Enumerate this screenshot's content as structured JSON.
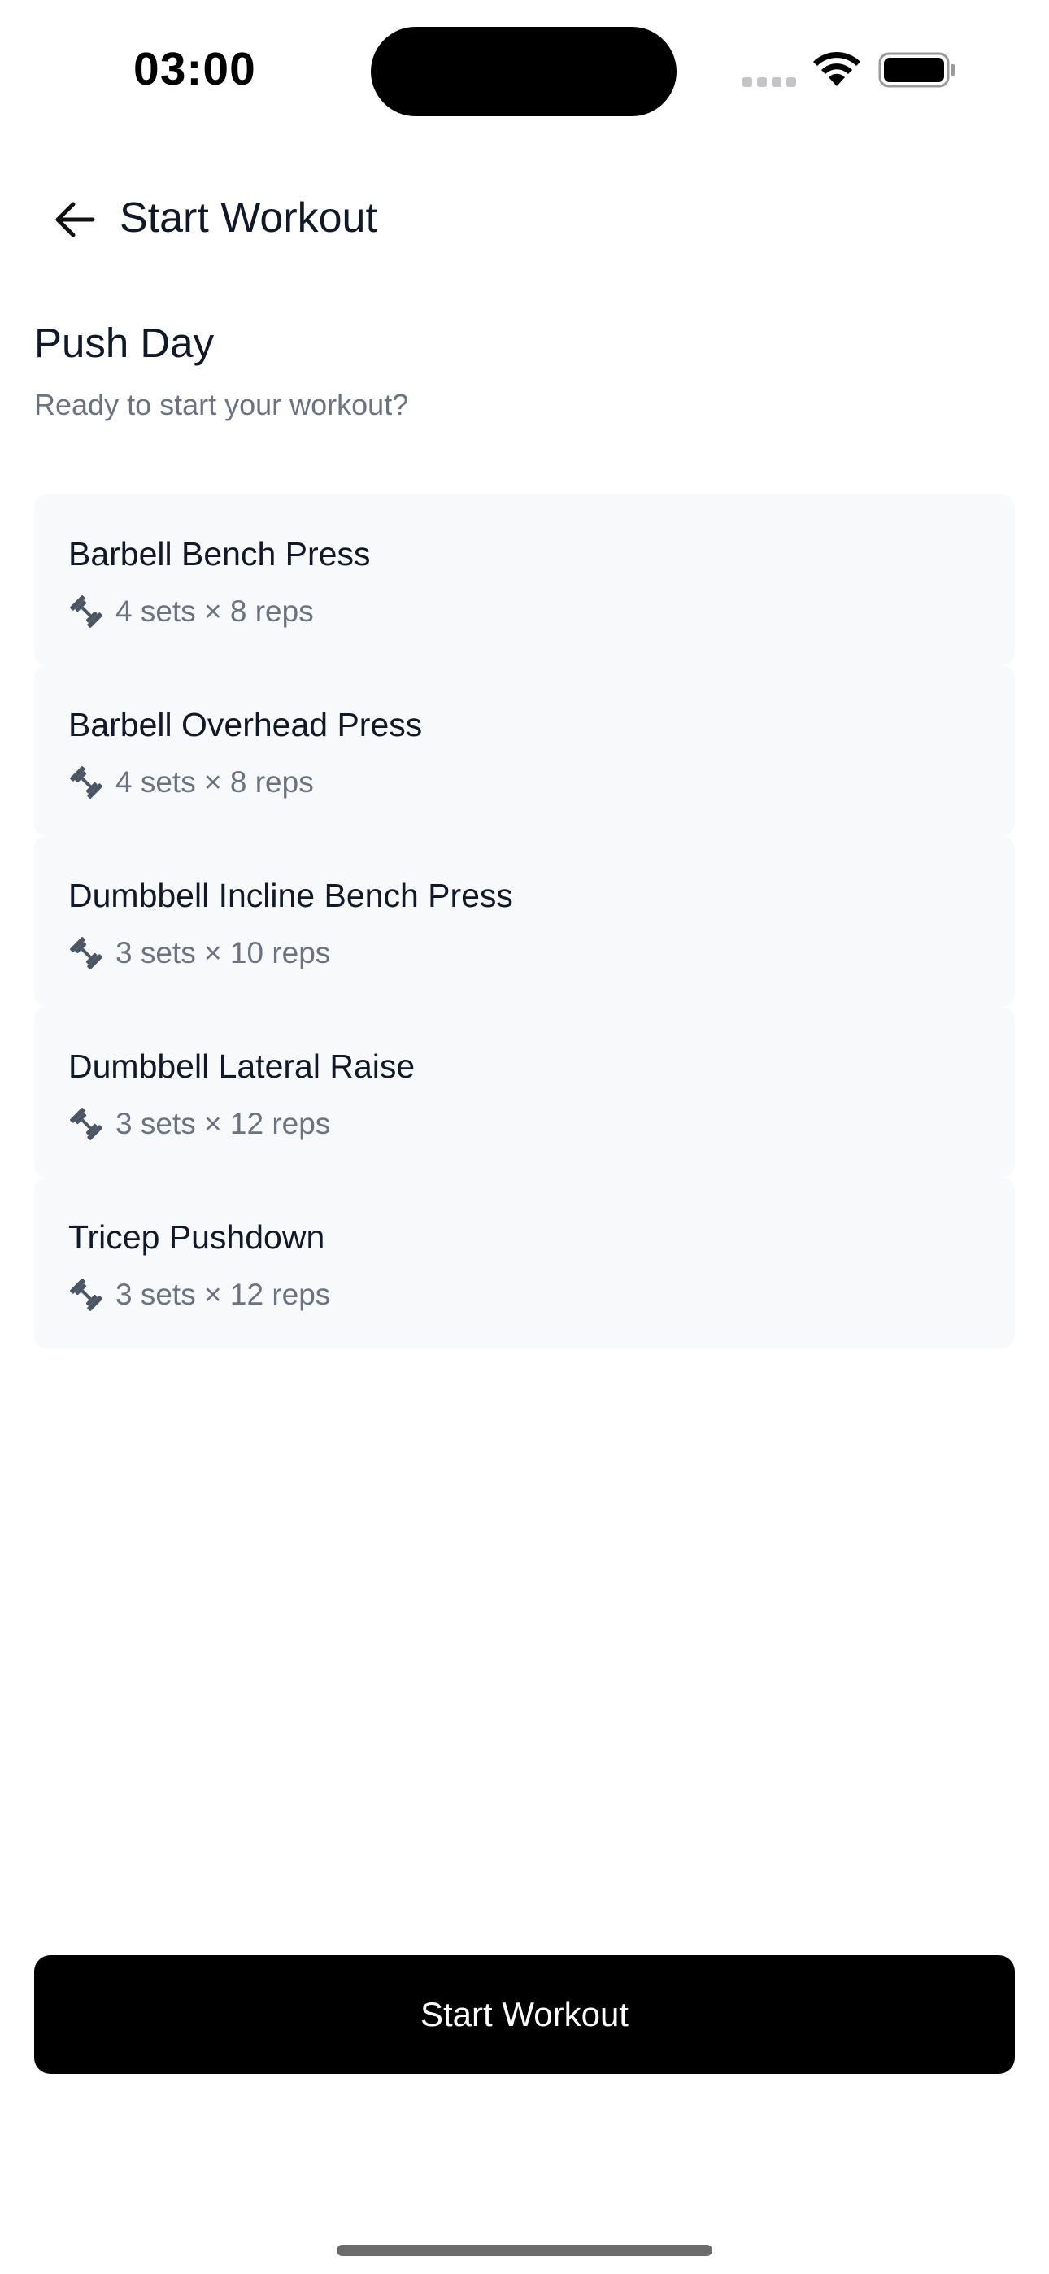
{
  "status_bar": {
    "time": "03:00",
    "icons": [
      "signal-icon",
      "wifi-icon",
      "battery-icon"
    ]
  },
  "header": {
    "back_icon": "arrow-left-icon",
    "title": "Start Workout"
  },
  "workout": {
    "title": "Push Day",
    "subtitle": "Ready to start your workout?"
  },
  "exercises": [
    {
      "name": "Barbell Bench Press",
      "sets": "4 sets × 8 reps",
      "icon": "dumbbell-icon"
    },
    {
      "name": "Barbell Overhead Press",
      "sets": "4 sets × 8 reps",
      "icon": "dumbbell-icon"
    },
    {
      "name": "Dumbbell Incline Bench Press",
      "sets": "3 sets × 10 reps",
      "icon": "dumbbell-icon"
    },
    {
      "name": "Dumbbell Lateral Raise",
      "sets": "3 sets × 12 reps",
      "icon": "dumbbell-icon"
    },
    {
      "name": "Tricep Pushdown",
      "sets": "3 sets × 12 reps",
      "icon": "dumbbell-icon"
    }
  ],
  "cta": {
    "label": "Start Workout"
  },
  "colors": {
    "text_primary": "#111827",
    "text_secondary": "#6b7280",
    "card_background": "#f8f9fb",
    "button_background": "#000000",
    "button_text": "#ffffff"
  }
}
